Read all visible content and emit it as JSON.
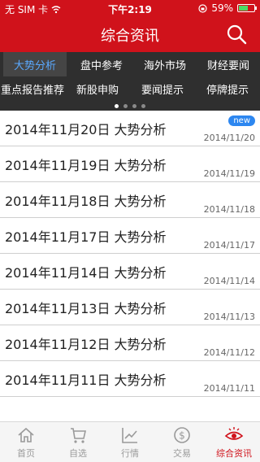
{
  "status": {
    "carrier": "无 SIM 卡",
    "time": "下午2:19",
    "battery": "59%",
    "battery_level": 0.59
  },
  "header": {
    "title": "综合资讯"
  },
  "tabs": {
    "row1": [
      "大势分析",
      "盘中参考",
      "海外市场",
      "财经要闻"
    ],
    "row2": [
      "重点报告推荐",
      "新股申购",
      "要闻提示",
      "停牌提示"
    ],
    "active": "大势分析",
    "pages": 4,
    "current_page": 1
  },
  "articles": [
    {
      "title": "2014年11月20日 大势分析",
      "date": "2014/11/20",
      "badge": "new"
    },
    {
      "title": "2014年11月19日 大势分析",
      "date": "2014/11/19"
    },
    {
      "title": "2014年11月18日 大势分析",
      "date": "2014/11/18"
    },
    {
      "title": "2014年11月17日 大势分析",
      "date": "2014/11/17"
    },
    {
      "title": "2014年11月14日 大势分析",
      "date": "2014/11/14"
    },
    {
      "title": "2014年11月13日 大势分析",
      "date": "2014/11/13"
    },
    {
      "title": "2014年11月12日 大势分析",
      "date": "2014/11/12"
    },
    {
      "title": "2014年11月11日 大势分析",
      "date": "2014/11/11"
    }
  ],
  "tabbar": [
    {
      "label": "首页",
      "icon": "home-icon"
    },
    {
      "label": "自选",
      "icon": "cart-icon"
    },
    {
      "label": "行情",
      "icon": "chart-icon"
    },
    {
      "label": "交易",
      "icon": "dollar-icon"
    },
    {
      "label": "综合资讯",
      "icon": "eye-icon",
      "active": true
    }
  ],
  "colors": {
    "brand_red": "#d0121b",
    "tab_bg": "#2f2f2f",
    "active_tab_text": "#5aa9ff",
    "badge_blue": "#2d87f0"
  }
}
